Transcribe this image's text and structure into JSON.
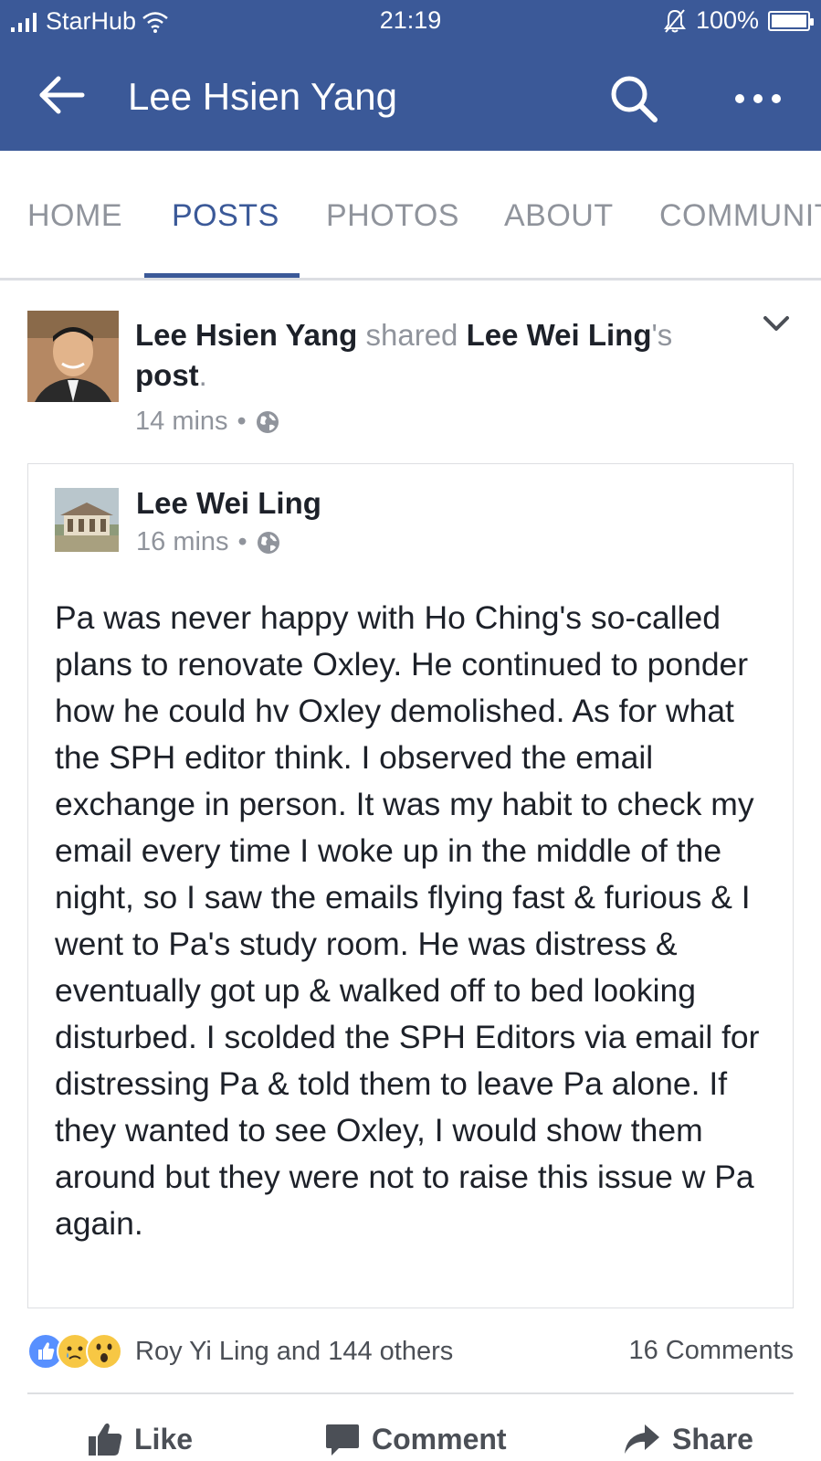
{
  "status_bar": {
    "carrier": "StarHub",
    "time": "21:19",
    "battery": "100%",
    "battery_level": 1.0
  },
  "header": {
    "title": "Lee Hsien Yang"
  },
  "tabs": [
    {
      "label": "HOME"
    },
    {
      "label": "POSTS"
    },
    {
      "label": "PHOTOS"
    },
    {
      "label": "ABOUT"
    },
    {
      "label": "COMMUNIT"
    }
  ],
  "active_tab": "POSTS",
  "post": {
    "author": "Lee Hsien Yang",
    "verb": "shared",
    "shared_from": "Lee Wei Ling",
    "possessive": "'s",
    "post_word": "post",
    "period": ".",
    "time": "14 mins",
    "separator": "•"
  },
  "shared_post": {
    "author": "Lee Wei Ling",
    "time": "16 mins",
    "separator": "•",
    "text": "Pa was never happy with Ho Ching's so-called plans to renovate Oxley.  He continued to ponder how he could hv Oxley demolished.  As for what the SPH editor think. I observed the email exchange in person. It was my habit to check my email every time I woke up in the middle of the night, so I saw the emails flying fast & furious & I went to Pa's study room. He was distress & eventually got up & walked off to bed looking disturbed. I scolded the SPH Editors via email for distressing Pa & told them to leave Pa alone. If they wanted to see Oxley, I would show them around but they were not to raise this issue w Pa again."
  },
  "engagement": {
    "reactions_text": "Roy Yi Ling and 144 others",
    "comments": "16 Comments"
  },
  "actions": {
    "like": "Like",
    "comment": "Comment",
    "share": "Share"
  },
  "colors": {
    "brand": "#3b5998",
    "like_blue": "#5890ff",
    "emoji_yellow": "#f7c744"
  }
}
